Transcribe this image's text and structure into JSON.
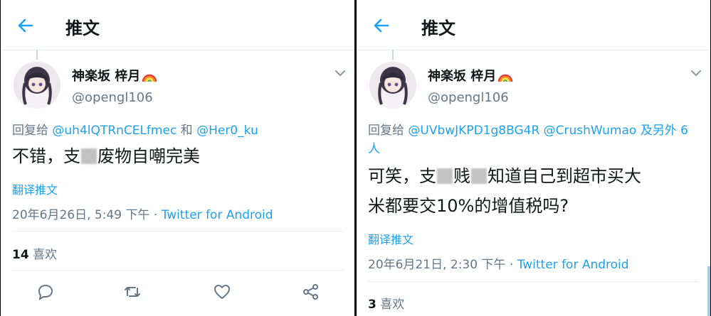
{
  "left": {
    "header_title": "推文",
    "display_name": "神楽坂 梓月",
    "handle": "@opengl106",
    "reply_prefix": "回复给 ",
    "mentions": [
      "@uh4lQTRnCELfmec",
      "@Her0_ku"
    ],
    "mention_joiner": " 和 ",
    "text_before": "不错，支",
    "text_after": "废物自嘲完美",
    "translate": "翻译推文",
    "timestamp": "20年6月26日, 5:49 下午 · ",
    "client": "Twitter for Android",
    "likes_count": "14",
    "likes_label": " 喜欢"
  },
  "right": {
    "header_title": "推文",
    "display_name": "神楽坂 梓月",
    "handle": "@opengl106",
    "reply_prefix": "回复给 ",
    "mentions": [
      "@UVbwJKPD1g8BG4R",
      "@CrushWumao"
    ],
    "reply_suffix": " 及另外 6 人",
    "text_line1_a": "可笑，支",
    "text_line1_b": "贱",
    "text_line1_c": "知道自己到超市买大",
    "text_line2": "米都要交10%的增值税吗?",
    "translate": "翻译推文",
    "timestamp": "20年6月21日, 2:30 下午 · ",
    "client": "Twitter for Android",
    "likes_count": "3",
    "likes_label": " 喜欢"
  },
  "icons": [
    "back-arrow-icon",
    "rainbow-icon",
    "chevron-down-icon",
    "reply-icon",
    "retweet-icon",
    "like-icon",
    "share-icon"
  ],
  "colors": {
    "accent": "#1da1f2",
    "text": "#14171a",
    "secondary": "#657786",
    "divider": "#e6ecf0"
  }
}
